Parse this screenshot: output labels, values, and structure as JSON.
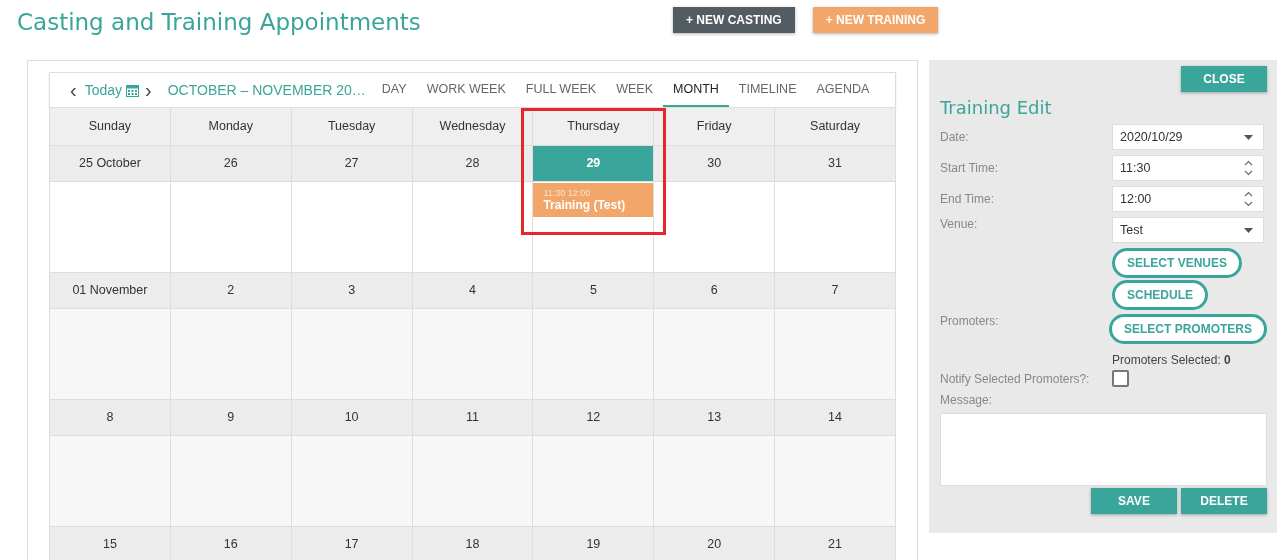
{
  "page": {
    "title": "Casting and Training Appointments"
  },
  "actions": [
    {
      "label": "+ NEW CASTING",
      "kind": "dark"
    },
    {
      "label": "+ NEW TRAINING",
      "kind": "accent"
    }
  ],
  "toolbar": {
    "prev": "‹",
    "today": "Today",
    "next": "›",
    "range": "OCTOBER – NOVEMBER 20…",
    "views": [
      {
        "label": "DAY",
        "selected": false
      },
      {
        "label": "WORK WEEK",
        "selected": false
      },
      {
        "label": "FULL WEEK",
        "selected": false
      },
      {
        "label": "WEEK",
        "selected": false
      },
      {
        "label": "MONTH",
        "selected": true
      },
      {
        "label": "TIMELINE",
        "selected": false
      },
      {
        "label": "AGENDA",
        "selected": false
      }
    ]
  },
  "calendar": {
    "weekdays": [
      "Sunday",
      "Monday",
      "Tuesday",
      "Wednesday",
      "Thursday",
      "Friday",
      "Saturday"
    ],
    "weeks": [
      {
        "current": true,
        "days": [
          {
            "label": "25 October",
            "today": false,
            "annotated": false
          },
          {
            "label": "26",
            "today": false,
            "annotated": false
          },
          {
            "label": "27",
            "today": false,
            "annotated": false
          },
          {
            "label": "28",
            "today": false,
            "annotated": false
          },
          {
            "label": "29",
            "today": true,
            "annotated": true,
            "events": [
              {
                "time": "11:30 12:00",
                "title": "Training (Test)"
              }
            ]
          },
          {
            "label": "30",
            "today": false,
            "annotated": false
          },
          {
            "label": "31",
            "today": false,
            "annotated": false
          }
        ]
      },
      {
        "current": false,
        "days": [
          {
            "label": "01 November",
            "today": false,
            "annotated": false
          },
          {
            "label": "2",
            "today": false,
            "annotated": false
          },
          {
            "label": "3",
            "today": false,
            "annotated": false
          },
          {
            "label": "4",
            "today": false,
            "annotated": false
          },
          {
            "label": "5",
            "today": false,
            "annotated": false
          },
          {
            "label": "6",
            "today": false,
            "annotated": false
          },
          {
            "label": "7",
            "today": false,
            "annotated": false
          }
        ]
      },
      {
        "current": false,
        "days": [
          {
            "label": "8",
            "today": false,
            "annotated": false
          },
          {
            "label": "9",
            "today": false,
            "annotated": false
          },
          {
            "label": "10",
            "today": false,
            "annotated": false
          },
          {
            "label": "11",
            "today": false,
            "annotated": false
          },
          {
            "label": "12",
            "today": false,
            "annotated": false
          },
          {
            "label": "13",
            "today": false,
            "annotated": false
          },
          {
            "label": "14",
            "today": false,
            "annotated": false
          }
        ]
      },
      {
        "days": [
          {
            "label": "15",
            "today": false,
            "annotated": false
          },
          {
            "label": "16",
            "today": false,
            "annotated": false
          },
          {
            "label": "17",
            "today": false,
            "annotated": false
          },
          {
            "label": "18",
            "today": false,
            "annotated": false
          },
          {
            "label": "19",
            "today": false,
            "annotated": false
          },
          {
            "label": "20",
            "today": false,
            "annotated": false
          },
          {
            "label": "21",
            "today": false,
            "annotated": false
          }
        ]
      }
    ]
  },
  "editor": {
    "close": "CLOSE",
    "title": "Training Edit",
    "fields": [
      {
        "label": "Date:",
        "value": "2020/10/29",
        "kind": "dropdown"
      },
      {
        "label": "Start Time:",
        "value": "11:30",
        "kind": "time"
      },
      {
        "label": "End Time:",
        "value": "12:00",
        "kind": "time"
      },
      {
        "label": "Venue:",
        "value": "Test",
        "kind": "dropdown"
      }
    ],
    "venue_buttons": [
      "SELECT VENUES",
      "SCHEDULE"
    ],
    "promoters_label": "Promoters:",
    "promoters_button": "SELECT PROMOTERS",
    "promoters_selected": "Promoters Selected: **0**",
    "notify": {
      "label": "Notify Selected Promoters?:",
      "checked": false
    },
    "message_label": "Message:",
    "buttons": [
      "SAVE",
      "DELETE"
    ]
  }
}
